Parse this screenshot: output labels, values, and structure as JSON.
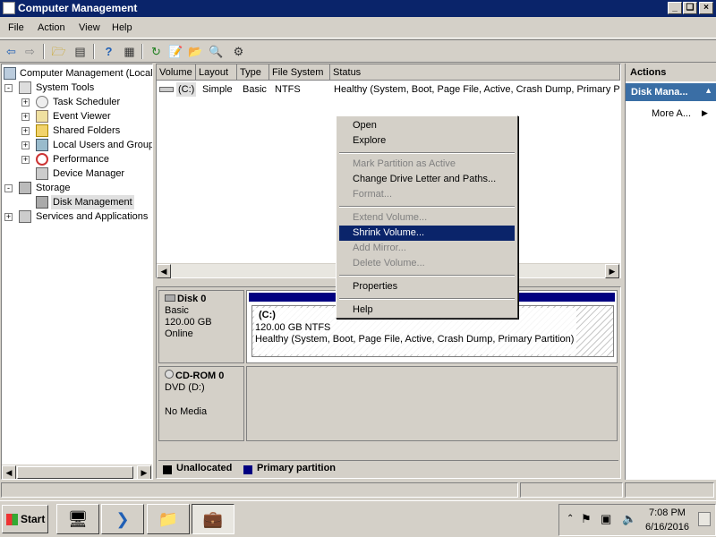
{
  "window": {
    "title": "Computer Management"
  },
  "menubar": {
    "items": [
      "File",
      "Action",
      "View",
      "Help"
    ]
  },
  "tree": {
    "root": "Computer Management (Local)",
    "items": [
      {
        "label": "System Tools",
        "expander": "-"
      },
      {
        "label": "Task Scheduler",
        "expander": "+"
      },
      {
        "label": "Event Viewer",
        "expander": "+"
      },
      {
        "label": "Shared Folders",
        "expander": "+"
      },
      {
        "label": "Local Users and Groups",
        "expander": "+"
      },
      {
        "label": "Performance",
        "expander": "+"
      },
      {
        "label": "Device Manager",
        "expander": ""
      },
      {
        "label": "Storage",
        "expander": "-"
      },
      {
        "label": "Disk Management",
        "expander": ""
      },
      {
        "label": "Services and Applications",
        "expander": "+"
      }
    ]
  },
  "volume_list": {
    "columns": [
      "Volume",
      "Layout",
      "Type",
      "File System",
      "Status"
    ],
    "rows": [
      {
        "volume": "(C:)",
        "layout": "Simple",
        "type": "Basic",
        "fs": "NTFS",
        "status": "Healthy (System, Boot, Page File, Active, Crash Dump, Primary Pa"
      }
    ]
  },
  "disks": [
    {
      "name": "Disk 0",
      "kind": "Basic",
      "size": "120.00 GB",
      "state": "Online",
      "partition": {
        "label": "(C:)",
        "size": "120.00 GB NTFS",
        "status": "Healthy (System, Boot, Page File, Active, Crash Dump, Primary Partition)"
      }
    },
    {
      "name": "CD-ROM 0",
      "kind": "DVD (D:)",
      "state": "No Media"
    }
  ],
  "legend": {
    "unallocated": "Unallocated",
    "primary": "Primary partition",
    "unallocated_color": "#000000",
    "primary_color": "#000080"
  },
  "actions": {
    "header": "Actions",
    "section": "Disk Mana...",
    "more": "More A..."
  },
  "context_menu": {
    "items": [
      {
        "label": "Open",
        "state": "enabled"
      },
      {
        "label": "Explore",
        "state": "enabled"
      },
      {
        "label": "Mark Partition as Active",
        "state": "disabled"
      },
      {
        "label": "Change Drive Letter and Paths...",
        "state": "enabled"
      },
      {
        "label": "Format...",
        "state": "disabled"
      },
      {
        "label": "Extend Volume...",
        "state": "disabled"
      },
      {
        "label": "Shrink Volume...",
        "state": "highlighted"
      },
      {
        "label": "Add Mirror...",
        "state": "disabled"
      },
      {
        "label": "Delete Volume...",
        "state": "disabled"
      },
      {
        "label": "Properties",
        "state": "enabled"
      },
      {
        "label": "Help",
        "state": "enabled"
      }
    ]
  },
  "taskbar": {
    "start_label": "Start",
    "time": "7:08 PM",
    "date": "6/16/2016"
  },
  "colors": {
    "titlebar": "#0a246a",
    "highlight": "#0a246a",
    "actions_header": "#3a6ea5"
  }
}
